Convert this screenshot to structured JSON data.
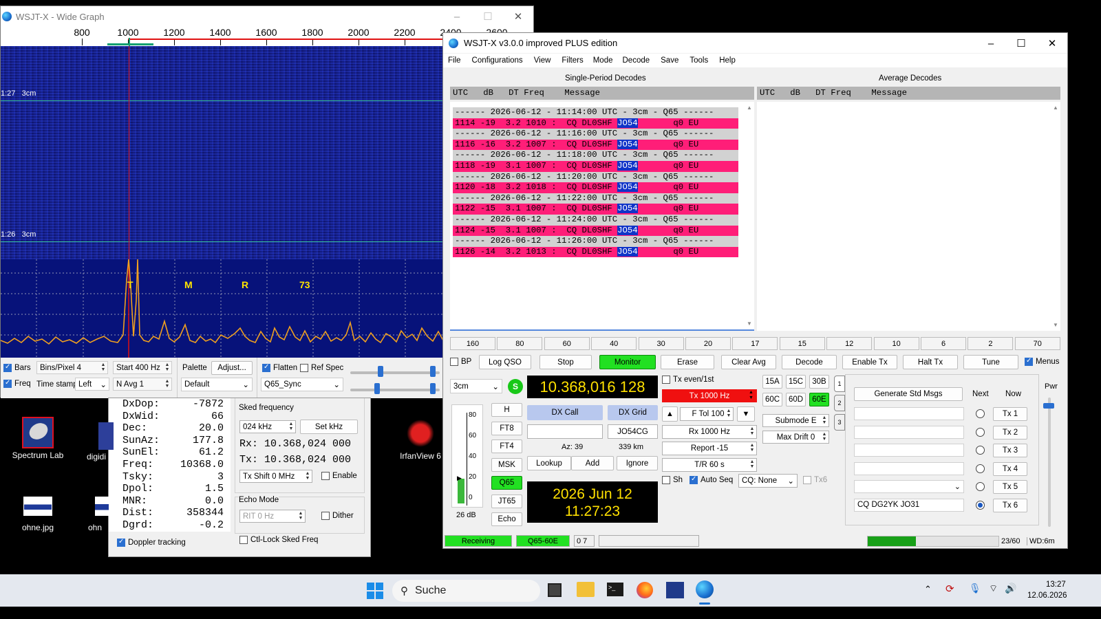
{
  "wide_graph": {
    "title": "WSJT-X - Wide Graph",
    "freq_ticks": [
      "800",
      "1000",
      "1200",
      "1400",
      "1600",
      "1800",
      "2000",
      "2200",
      "2400",
      "2600"
    ],
    "timestamps": [
      {
        "time": "1:27",
        "band": "3cm"
      },
      {
        "time": "1:26",
        "band": "3cm"
      }
    ],
    "markers": [
      "T",
      "M",
      "R",
      "73"
    ],
    "controls": {
      "bars_label": "Bars",
      "freq_label": "Freq",
      "bins_per_pixel": "Bins/Pixel  4",
      "start": "Start 400 Hz",
      "time_stamp_label": "Time stamp",
      "time_stamp_value": "Left",
      "navg": "N Avg 1",
      "palette_label": "Palette",
      "adjust_label": "Adjust...",
      "palette_value": "Default",
      "flatten_label": "Flatten",
      "refspec_label": "Ref Spec",
      "sync_value": "Q65_Sync"
    }
  },
  "astro": {
    "rows": [
      {
        "label": "DxDop:",
        "value": "-7872"
      },
      {
        "label": "DxWid:",
        "value": "66"
      },
      {
        "label": "Dec:",
        "value": "20.0"
      },
      {
        "label": "SunAz:",
        "value": "177.8"
      },
      {
        "label": "SunEl:",
        "value": "61.2"
      },
      {
        "label": "Freq:",
        "value": "10368.0"
      },
      {
        "label": "Tsky:",
        "value": "3"
      },
      {
        "label": "Dpol:",
        "value": "1.5"
      },
      {
        "label": "MNR:",
        "value": "0.0"
      },
      {
        "label": "Dist:",
        "value": "358344"
      },
      {
        "label": "Dgrd:",
        "value": "-0.2"
      }
    ],
    "sked_title": "Sked frequency",
    "sked_value": "024 kHz",
    "set_khz": "Set kHz",
    "rx_line": "Rx: 10.368,024 000",
    "tx_line": "Tx: 10.368,024 000",
    "tx_shift": "Tx Shift  0  MHz",
    "enable": "Enable",
    "echo_title": "Echo Mode",
    "rit": "RIT  0  Hz",
    "dither": "Dither",
    "doppler": "Doppler tracking",
    "ctl_lock": "Ctl-Lock Sked Freq"
  },
  "desktop_icons": [
    {
      "label": "Spectrum Lab"
    },
    {
      "label": "digidi"
    },
    {
      "label": "IrfanView 6"
    },
    {
      "label": "ohne.jpg"
    },
    {
      "label": "ohn"
    }
  ],
  "main": {
    "title": "WSJT-X   v3.0.0  improved PLUS edition",
    "menu": [
      "File",
      "Configurations",
      "View",
      "Filters",
      "Mode",
      "Decode",
      "Save",
      "Tools",
      "Help"
    ],
    "single_title": "Single-Period Decodes",
    "average_title": "Average Decodes",
    "col_header": "UTC   dB   DT Freq    Message",
    "decodes": [
      {
        "sep": "------ 2026-06-12 - 11:14:00 UTC - 3cm - Q65 ------",
        "pre": "1114 -19  3.2 1010 :  CQ DL0SHF ",
        "grid": "JO54",
        "post": "       q0 EU"
      },
      {
        "sep": "------ 2026-06-12 - 11:16:00 UTC - 3cm - Q65 ------",
        "pre": "1116 -16  3.2 1007 :  CQ DL0SHF ",
        "grid": "JO54",
        "post": "       q0 EU"
      },
      {
        "sep": "------ 2026-06-12 - 11:18:00 UTC - 3cm - Q65 ------",
        "pre": "1118 -19  3.1 1007 :  CQ DL0SHF ",
        "grid": "JO54",
        "post": "       q0 EU"
      },
      {
        "sep": "------ 2026-06-12 - 11:20:00 UTC - 3cm - Q65 ------",
        "pre": "1120 -18  3.2 1018 :  CQ DL0SHF ",
        "grid": "JO54",
        "post": "       q0 EU"
      },
      {
        "sep": "------ 2026-06-12 - 11:22:00 UTC - 3cm - Q65 ------",
        "pre": "1122 -15  3.1 1007 :  CQ DL0SHF ",
        "grid": "JO54",
        "post": "       q0 EU"
      },
      {
        "sep": "------ 2026-06-12 - 11:24:00 UTC - 3cm - Q65 ------",
        "pre": "1124 -15  3.1 1007 :  CQ DL0SHF ",
        "grid": "JO54",
        "post": "       q0 EU"
      },
      {
        "sep": "------ 2026-06-12 - 11:26:00 UTC - 3cm - Q65 ------",
        "pre": "1126 -14  3.2 1013 :  CQ DL0SHF ",
        "grid": "JO54",
        "post": "       q0 EU"
      }
    ],
    "bands": [
      "160",
      "80",
      "60",
      "40",
      "30",
      "20",
      "17",
      "15",
      "12",
      "10",
      "6",
      "2",
      "70"
    ],
    "buttons": {
      "bp": "BP",
      "log_qso": "Log QSO",
      "stop": "Stop",
      "monitor": "Monitor",
      "erase": "Erase",
      "clear_avg": "Clear Avg",
      "decode": "Decode",
      "enable_tx": "Enable Tx",
      "halt_tx": "Halt Tx",
      "tune": "Tune",
      "menus": "Menus"
    },
    "band_select": "3cm",
    "s_label": "S",
    "dial_freq": "10.368,016 128",
    "date": "2026 Jun 12",
    "time": "11:27:23",
    "level_db": "26 dB",
    "scale": [
      "80",
      "60",
      "40",
      "20",
      "0"
    ],
    "modes": [
      "H",
      "FT8",
      "FT4",
      "MSK",
      "Q65",
      "JT65",
      "Echo"
    ],
    "dx_call_label": "DX Call",
    "dx_grid_label": "DX Grid",
    "dx_call": "",
    "dx_grid": "JO54CG",
    "az": "Az: 39",
    "dist": "339 km",
    "lookup": "Lookup",
    "add": "Add",
    "ignore": "Ignore",
    "tx_even": "Tx even/1st",
    "tx_freq": "Tx  1000  Hz",
    "ftol": "F Tol  100",
    "rx_freq": "Rx  1000  Hz",
    "report": "Report -15",
    "tr": "T/R  60  s",
    "sh": "Sh",
    "auto_seq": "Auto Seq",
    "cq": "CQ: None",
    "tx6": "Tx6",
    "submodes": [
      "15A",
      "15C",
      "30B",
      "60C",
      "60D",
      "60E"
    ],
    "submode": "Submode E",
    "max_drift": "Max Drift  0",
    "tabs": [
      "1",
      "2",
      "3"
    ],
    "gen_std": "Generate Std Msgs",
    "next": "Next",
    "now": "Now",
    "tx_buttons": [
      "Tx 1",
      "Tx 2",
      "Tx 3",
      "Tx 4",
      "Tx 5",
      "Tx 6"
    ],
    "tx6_msg": "CQ DG2YK JO31",
    "pwr": "Pwr",
    "status": {
      "receiving": "Receiving",
      "mode": "Q65-60E",
      "count": "0  7",
      "progress": "23/60",
      "wd": "WD:6m"
    }
  },
  "taskbar": {
    "search": "Suche",
    "time": "13:27",
    "date": "12.06.2026"
  }
}
